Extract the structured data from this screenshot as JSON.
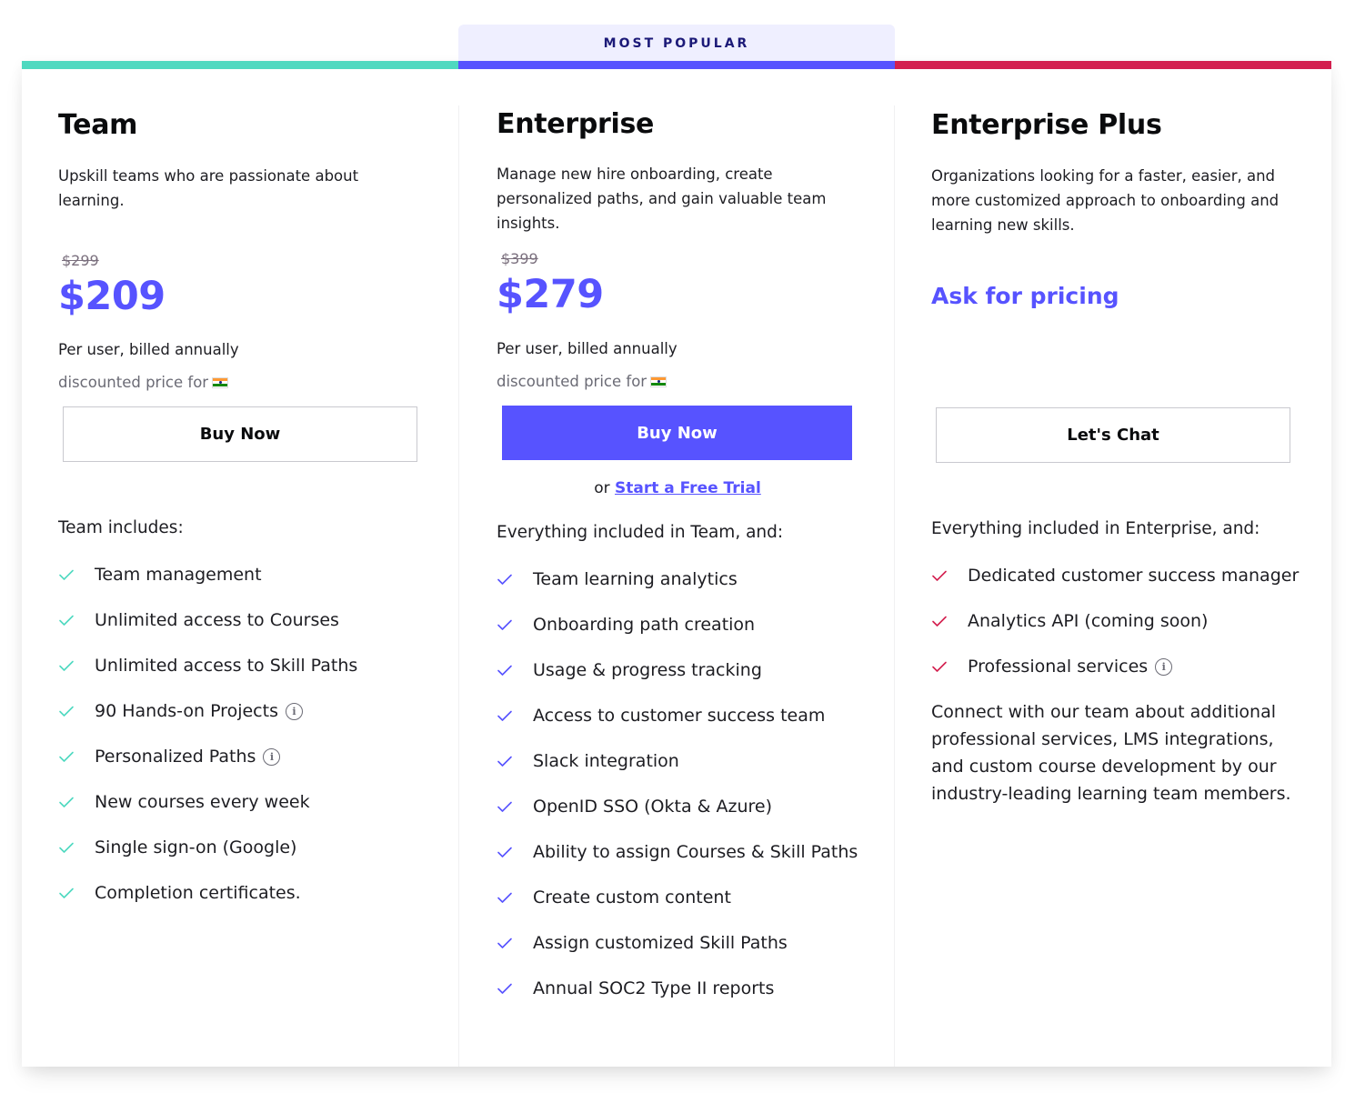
{
  "colors": {
    "team_accent": "#4fd9c0",
    "enterprise_accent": "#5753ff",
    "plus_accent": "#d31f4f",
    "price": "#5753ff"
  },
  "badge": {
    "label": "MOST POPULAR"
  },
  "plans": {
    "team": {
      "title": "Team",
      "description": "Upskill teams who are passionate about learning.",
      "old_price": "$299",
      "price": "$209",
      "billing": "Per user, billed annually",
      "discount_label": "discounted price for",
      "discount_flag": "india-flag-icon",
      "cta": "Buy Now",
      "includes_heading": "Team includes:",
      "features": [
        {
          "label": "Team management",
          "info": false
        },
        {
          "label": "Unlimited access to Courses",
          "info": false
        },
        {
          "label": "Unlimited access to Skill Paths",
          "info": false
        },
        {
          "label": "90 Hands-on Projects",
          "info": true
        },
        {
          "label": "Personalized Paths",
          "info": true
        },
        {
          "label": "New courses every week",
          "info": false
        },
        {
          "label": "Single sign-on (Google)",
          "info": false
        },
        {
          "label": "Completion certificates.",
          "info": false
        }
      ]
    },
    "enterprise": {
      "title": "Enterprise",
      "description": "Manage new hire onboarding, create personalized paths, and gain valuable team insights.",
      "old_price": "$399",
      "price": "$279",
      "billing": "Per user, billed annually",
      "discount_label": "discounted price for",
      "discount_flag": "india-flag-icon",
      "cta": "Buy Now",
      "trial_prefix": "or",
      "trial_link": "Start a Free Trial",
      "includes_heading": "Everything included in Team, and:",
      "features": [
        {
          "label": "Team learning analytics",
          "info": false
        },
        {
          "label": "Onboarding path creation",
          "info": false
        },
        {
          "label": "Usage & progress tracking",
          "info": false
        },
        {
          "label": "Access to customer success team",
          "info": false
        },
        {
          "label": "Slack integration",
          "info": false
        },
        {
          "label": "OpenID SSO (Okta & Azure)",
          "info": false
        },
        {
          "label": "Ability to assign Courses & Skill Paths",
          "info": false
        },
        {
          "label": "Create custom content",
          "info": false
        },
        {
          "label": "Assign customized Skill Paths",
          "info": false
        },
        {
          "label": "Annual SOC2 Type II reports",
          "info": false
        }
      ]
    },
    "plus": {
      "title": "Enterprise Plus",
      "description": "Organizations looking for a faster, easier, and more customized approach to onboarding and learning new skills.",
      "price_label": "Ask for pricing",
      "cta": "Let's Chat",
      "includes_heading": "Everything included in Enterprise, and:",
      "features": [
        {
          "label": "Dedicated customer success manager",
          "info": false
        },
        {
          "label": "Analytics API (coming soon)",
          "info": false
        },
        {
          "label": "Professional services",
          "info": true
        }
      ],
      "extra_text": "Connect with our team about additional professional services, LMS integrations, and custom course development by our industry-leading learning team members."
    }
  }
}
